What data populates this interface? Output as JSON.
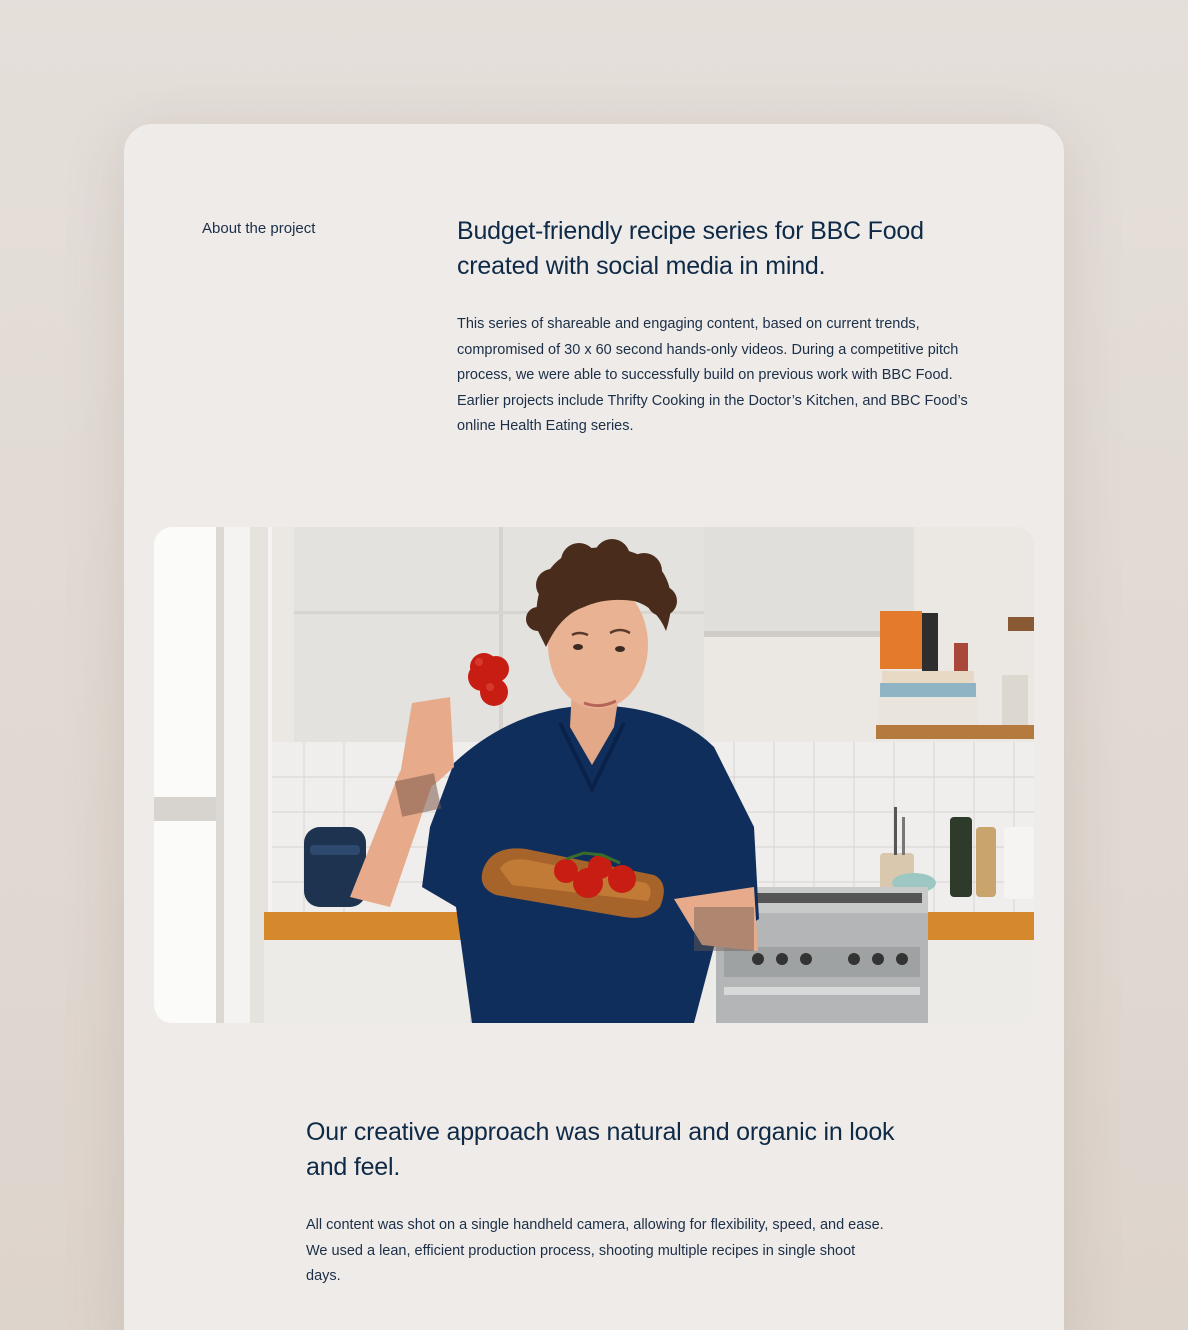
{
  "about": {
    "label": "About the project",
    "heading": "Budget-friendly recipe series for BBC Food created with social media in mind.",
    "body": "This series of shareable and engaging content, based on current trends, compromised of 30 x 60 second hands-only videos. During a competitive pitch process, we were able to successfully build on previous work with BBC Food. Earlier projects include Thrifty Cooking in the Doctor’s Kitchen, and BBC Food’s online Health Eating series."
  },
  "hero": {
    "icon": "photo-chef-with-tomatoes"
  },
  "approach": {
    "heading": "Our creative approach was natural and organic in look and feel.",
    "body": "All content was shot on a single handheld camera, allowing for flexibility, speed, and ease. We used a lean, efficient production process, shooting multiple recipes in single shoot days."
  },
  "colors": {
    "background": "#e5dfda",
    "card": "#efebe8",
    "text": "#0e2a47"
  }
}
